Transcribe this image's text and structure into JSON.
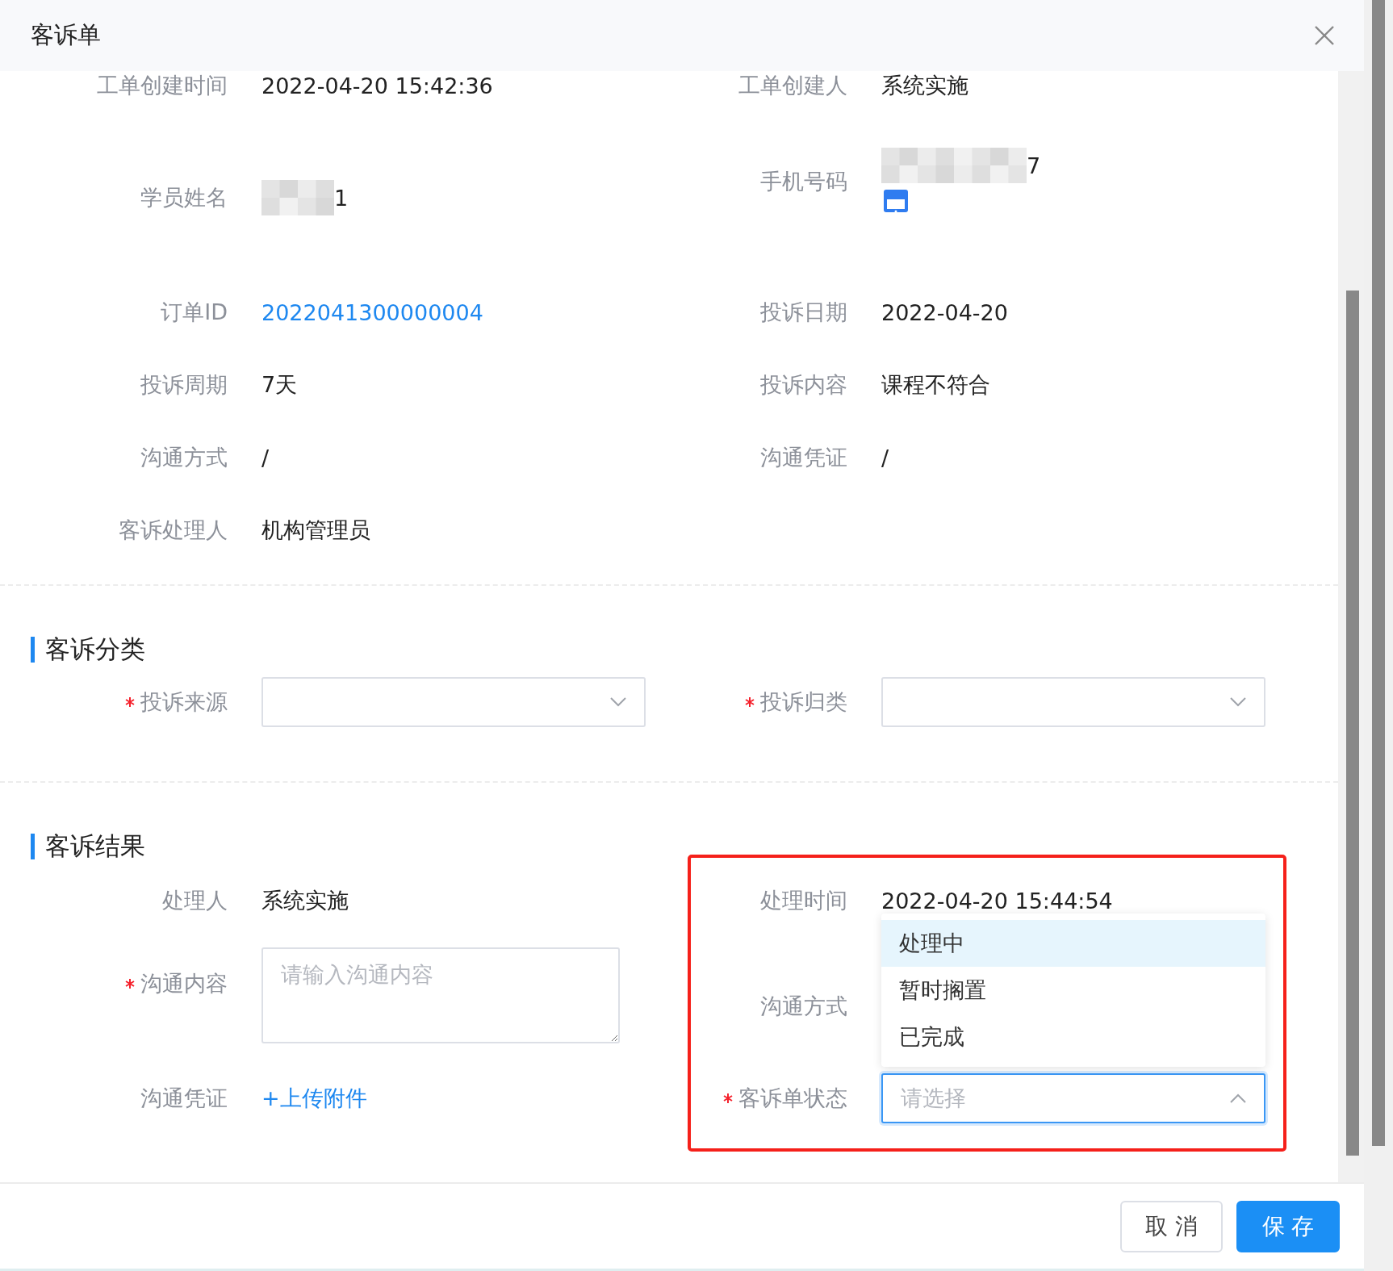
{
  "dialog": {
    "title": "客诉单"
  },
  "details": [
    {
      "left": {
        "label": "工单创建时间",
        "value": "2022-04-20 15:42:36",
        "kind": "text"
      },
      "right": {
        "label": "工单创建人",
        "value": "系统实施",
        "kind": "text"
      }
    },
    {
      "left": {
        "label": "学员姓名",
        "value": "1",
        "kind": "redacted"
      },
      "right": {
        "label": "手机号码",
        "value": "7",
        "kind": "phone"
      }
    },
    {
      "left": {
        "label": "订单ID",
        "value": "2022041300000004",
        "kind": "link"
      },
      "right": {
        "label": "投诉日期",
        "value": "2022-04-20",
        "kind": "text"
      }
    },
    {
      "left": {
        "label": "投诉周期",
        "value": "7天",
        "kind": "text"
      },
      "right": {
        "label": "投诉内容",
        "value": "课程不符合",
        "kind": "text"
      }
    },
    {
      "left": {
        "label": "沟通方式",
        "value": "/",
        "kind": "text"
      },
      "right": {
        "label": "沟通凭证",
        "value": "/",
        "kind": "text"
      }
    },
    {
      "left": {
        "label": "客诉处理人",
        "value": "机构管理员",
        "kind": "text"
      }
    }
  ],
  "classification": {
    "title": "客诉分类",
    "fields": [
      {
        "label": "投诉来源",
        "required": true,
        "kind": "select"
      },
      {
        "label": "投诉归类",
        "required": true,
        "kind": "select"
      }
    ]
  },
  "result": {
    "title": "客诉结果",
    "rows": [
      {
        "left": {
          "label": "处理人",
          "required": false,
          "kind": "text",
          "value": "系统实施"
        },
        "right": {
          "label": "处理时间",
          "required": false,
          "kind": "text",
          "value": "2022-04-20 15:44:54"
        }
      },
      {
        "left": {
          "label": "沟通内容",
          "required": true,
          "kind": "textarea",
          "placeholder": "请输入沟通内容"
        },
        "right": {
          "label": "沟通方式",
          "required": false,
          "kind": "empty"
        }
      },
      {
        "left": {
          "label": "沟通凭证",
          "required": false,
          "kind": "upload",
          "value": "+上传附件"
        },
        "right": {
          "label": "客诉单状态",
          "required": true,
          "kind": "select",
          "placeholder": "请选择",
          "expanded": true,
          "options": [
            {
              "label": "处理中",
              "selected": true
            },
            {
              "label": "暂时搁置",
              "selected": false
            },
            {
              "label": "已完成",
              "selected": false
            }
          ]
        }
      }
    ]
  },
  "footer": {
    "buttons": [
      {
        "label": "取 消",
        "kind": "default"
      },
      {
        "label": "保 存",
        "kind": "primary"
      }
    ]
  }
}
